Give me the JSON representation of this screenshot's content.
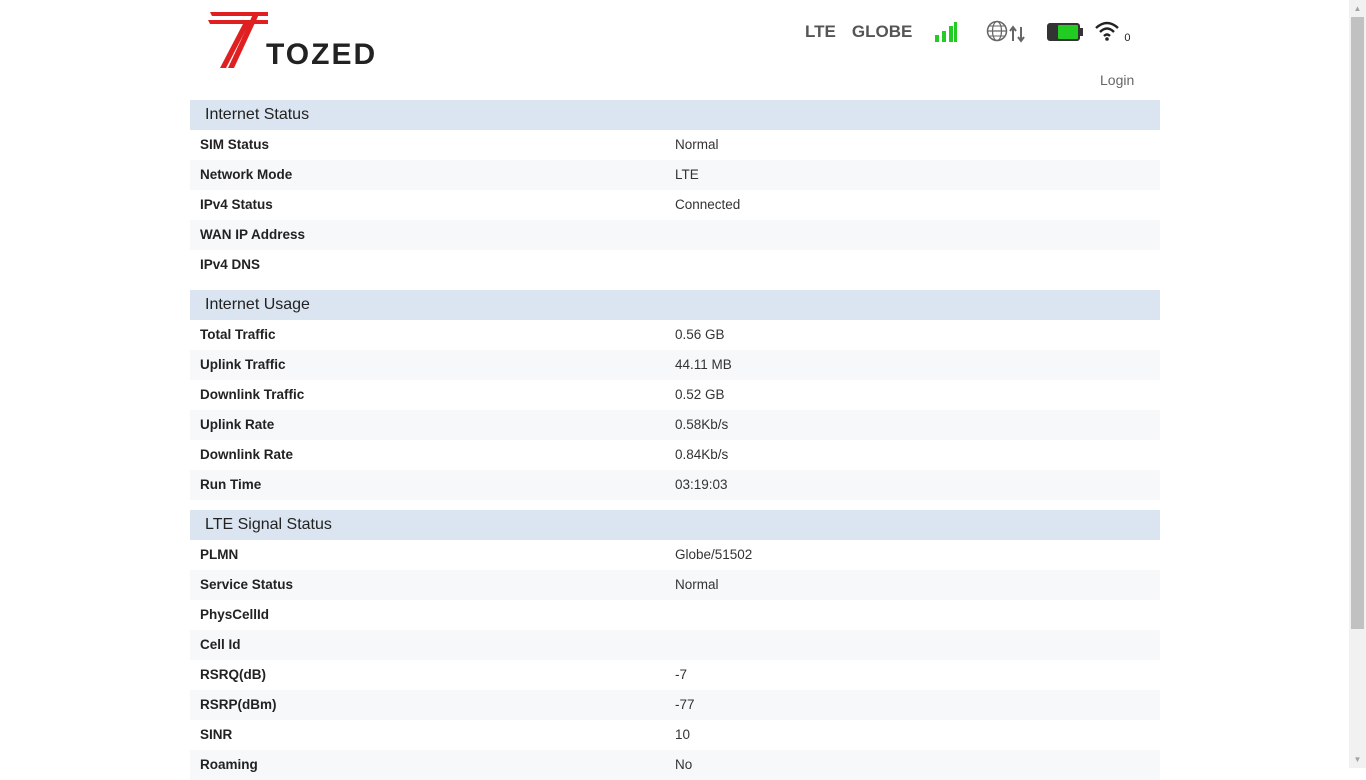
{
  "brand": {
    "logo_text": "TOZED"
  },
  "status": {
    "network_type": "LTE",
    "operator": "GLOBE",
    "signal_bars": 4,
    "wifi_clients": "0",
    "colors": {
      "signal": "#22cc22",
      "battery": "#22cc22",
      "logo_red": "#e02020"
    }
  },
  "login_label": "Login",
  "sections": {
    "internet_status": {
      "title": "Internet Status",
      "rows": [
        {
          "label": "SIM Status",
          "value": "Normal"
        },
        {
          "label": "Network Mode",
          "value": "LTE"
        },
        {
          "label": "IPv4 Status",
          "value": "Connected"
        },
        {
          "label": "WAN IP Address",
          "value": ""
        },
        {
          "label": "IPv4 DNS",
          "value": ""
        }
      ]
    },
    "internet_usage": {
      "title": "Internet Usage",
      "rows": [
        {
          "label": "Total Traffic",
          "value": "0.56 GB"
        },
        {
          "label": "Uplink Traffic",
          "value": "44.11 MB"
        },
        {
          "label": "Downlink Traffic",
          "value": "0.52 GB"
        },
        {
          "label": "Uplink Rate",
          "value": "0.58Kb/s"
        },
        {
          "label": "Downlink Rate",
          "value": "0.84Kb/s"
        },
        {
          "label": "Run Time",
          "value": "03:19:03"
        }
      ]
    },
    "lte_signal": {
      "title": "LTE Signal Status",
      "rows": [
        {
          "label": "PLMN",
          "value": "Globe/51502"
        },
        {
          "label": "Service Status",
          "value": "Normal"
        },
        {
          "label": "PhysCellId",
          "value": ""
        },
        {
          "label": "Cell Id",
          "value": ""
        },
        {
          "label": "RSRQ(dB)",
          "value": "-7"
        },
        {
          "label": "RSRP(dBm)",
          "value": "-77"
        },
        {
          "label": "SINR",
          "value": "10"
        },
        {
          "label": "Roaming",
          "value": "No"
        }
      ]
    }
  }
}
